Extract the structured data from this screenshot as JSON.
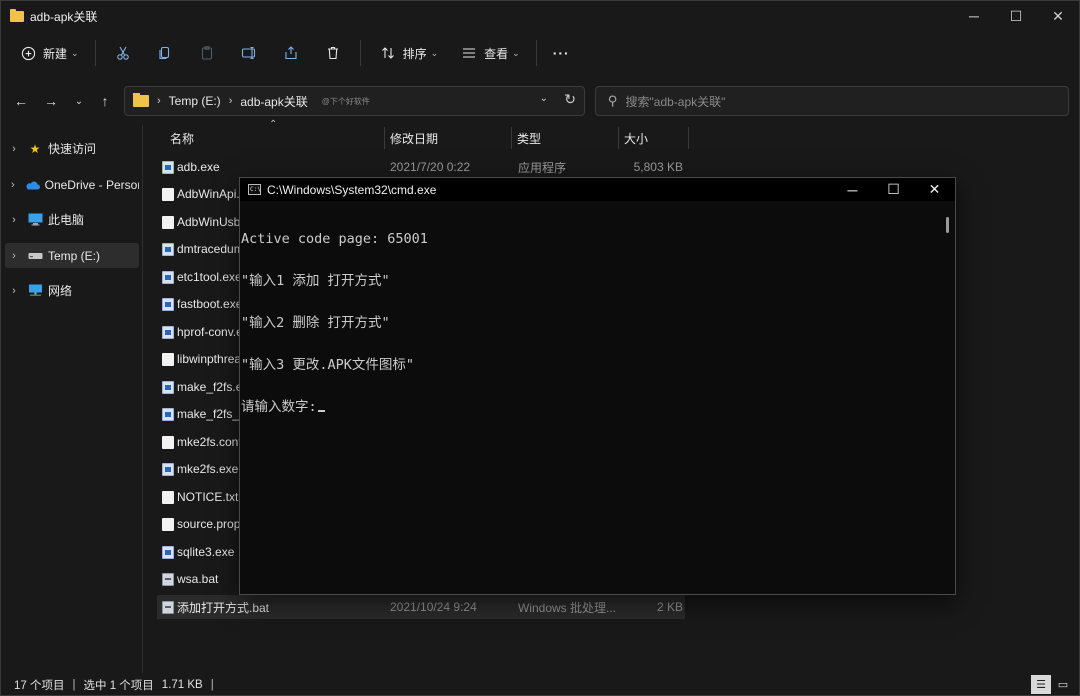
{
  "window": {
    "title": "adb-apk关联",
    "controls": [
      "─",
      "☐",
      "✕"
    ]
  },
  "toolbar": {
    "new_label": "新建",
    "sort_label": "排序",
    "view_label": "查看",
    "more_label": "···"
  },
  "address": {
    "crumbs": [
      "Temp (E:)",
      "adb-apk关联"
    ],
    "watermark": "@下个好软件",
    "search_placeholder": "搜索\"adb-apk关联\""
  },
  "sidebar": {
    "items": [
      {
        "label": "快速访问",
        "icon": "star-icon"
      },
      {
        "label": "OneDrive - Personal",
        "icon": "cloud-icon"
      },
      {
        "label": "此电脑",
        "icon": "monitor-icon"
      },
      {
        "label": "Temp (E:)",
        "icon": "drive-icon"
      },
      {
        "label": "网络",
        "icon": "network-icon"
      }
    ]
  },
  "columns": {
    "name": "名称",
    "date": "修改日期",
    "type": "类型",
    "size": "大小"
  },
  "files": [
    {
      "name": "adb.exe",
      "date": "2021/7/20 0:22",
      "type": "应用程序",
      "size": "5,803 KB",
      "kind": "exe"
    },
    {
      "name": "AdbWinApi.dll",
      "date": "",
      "type": "",
      "size": "",
      "kind": "doc"
    },
    {
      "name": "AdbWinUsbApi.dll",
      "date": "",
      "type": "",
      "size": "",
      "kind": "doc"
    },
    {
      "name": "dmtracedump.exe",
      "date": "",
      "type": "",
      "size": "",
      "kind": "exe"
    },
    {
      "name": "etc1tool.exe",
      "date": "",
      "type": "",
      "size": "",
      "kind": "exe"
    },
    {
      "name": "fastboot.exe",
      "date": "",
      "type": "",
      "size": "",
      "kind": "exe"
    },
    {
      "name": "hprof-conv.exe",
      "date": "",
      "type": "",
      "size": "",
      "kind": "exe"
    },
    {
      "name": "libwinpthread-1.dll",
      "date": "",
      "type": "",
      "size": "",
      "kind": "doc"
    },
    {
      "name": "make_f2fs.exe",
      "date": "",
      "type": "",
      "size": "",
      "kind": "exe"
    },
    {
      "name": "make_f2fs_casefold.exe",
      "date": "",
      "type": "",
      "size": "",
      "kind": "exe"
    },
    {
      "name": "mke2fs.conf",
      "date": "",
      "type": "",
      "size": "",
      "kind": "doc"
    },
    {
      "name": "mke2fs.exe",
      "date": "",
      "type": "",
      "size": "",
      "kind": "exe"
    },
    {
      "name": "NOTICE.txt",
      "date": "",
      "type": "",
      "size": "",
      "kind": "doc"
    },
    {
      "name": "source.properties",
      "date": "",
      "type": "",
      "size": "",
      "kind": "doc"
    },
    {
      "name": "sqlite3.exe",
      "date": "",
      "type": "",
      "size": "",
      "kind": "exe"
    },
    {
      "name": "wsa.bat",
      "date": "",
      "type": "",
      "size": "",
      "kind": "bat"
    },
    {
      "name": "添加打开方式.bat",
      "date": "2021/10/24 9:24",
      "type": "Windows 批处理...",
      "size": "2 KB",
      "kind": "bat",
      "selected": true
    }
  ],
  "status": {
    "count": "17 个项目",
    "selection": "选中 1 个项目",
    "selected_size": "1.71 KB"
  },
  "cmd": {
    "title": "C:\\Windows\\System32\\cmd.exe",
    "lines": [
      "Active code page: 65001",
      "\"输入1 添加 打开方式\"",
      "\"输入2 删除 打开方式\"",
      "\"输入3 更改.APK文件图标\"",
      "请输入数字:"
    ]
  }
}
